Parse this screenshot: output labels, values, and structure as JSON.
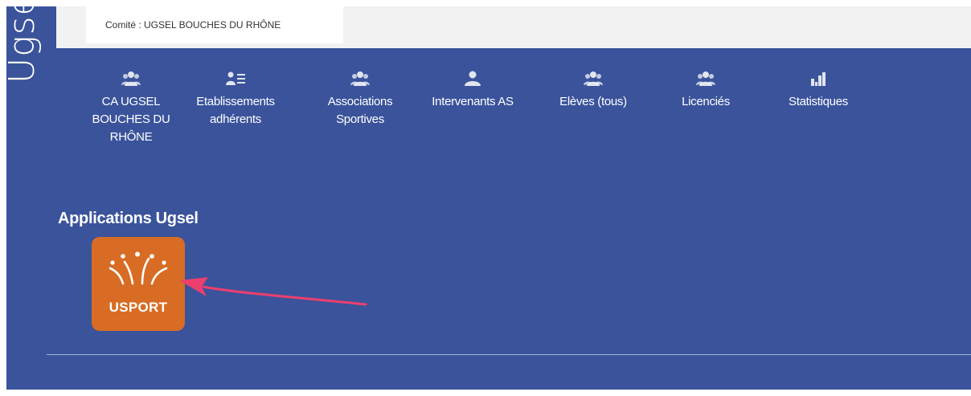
{
  "brand": {
    "logo_text": "Ugse"
  },
  "header": {
    "committee_label": "Comité : UGSEL BOUCHES DU RHÔNE"
  },
  "nav": {
    "items": [
      {
        "icon": "group-icon",
        "lines": [
          "CA UGSEL",
          "BOUCHES DU",
          "RHÔNE"
        ]
      },
      {
        "icon": "group-list-icon",
        "lines": [
          "Etablissements",
          "adhérents"
        ]
      },
      {
        "icon": "group-icon",
        "lines": [
          "Associations",
          "Sportives"
        ]
      },
      {
        "icon": "user-icon",
        "lines": [
          "Intervenants AS"
        ]
      },
      {
        "icon": "group-icon",
        "lines": [
          "Elèves (tous)"
        ]
      },
      {
        "icon": "group-icon",
        "lines": [
          "Licenciés"
        ]
      },
      {
        "icon": "bar-chart-icon",
        "lines": [
          "Statistiques"
        ]
      }
    ]
  },
  "applications": {
    "title": "Applications Ugsel",
    "apps": [
      {
        "label": "USPORT",
        "icon": "usport-logo-icon"
      }
    ]
  },
  "colors": {
    "background": "#3a539b",
    "top_bar": "#f2f2f2",
    "app_tile": "#d86c24",
    "annotation_arrow": "#ec3f6e",
    "text": "#ffffff"
  }
}
